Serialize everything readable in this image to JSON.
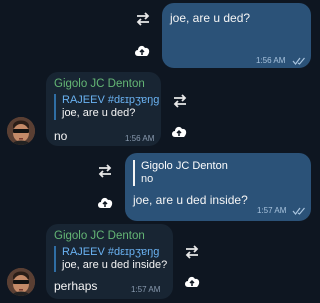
{
  "messages": [
    {
      "text": "joe, are u ded?",
      "time": "1:56 AM"
    },
    {
      "sender": "Gigolo JC Denton",
      "reply_name": "RAJEEV #dεɪpʒɐŋɡ",
      "reply_text": "joe, are u ded?",
      "text": "no",
      "time": "1:56 AM"
    },
    {
      "reply_name": "Gigolo JC Denton",
      "reply_text": "no",
      "text": "joe, are u ded inside?",
      "time": "1:57 AM"
    },
    {
      "sender": "Gigolo JC Denton",
      "reply_name": "RAJEEV #dεɪpʒɐŋɡ",
      "reply_text": "joe, are u ded inside?",
      "text": "perhaps",
      "time": "1:57 AM"
    }
  ],
  "icons": {
    "forward": "forward-arrows-icon",
    "share": "cloud-upload-icon",
    "read": "double-check-icon"
  },
  "colors": {
    "background": "#0e1621",
    "outgoing_bubble": "#2b5278",
    "incoming_bubble": "#182533",
    "sender_name": "#64b675",
    "reply_name": "#6ab2f2"
  }
}
